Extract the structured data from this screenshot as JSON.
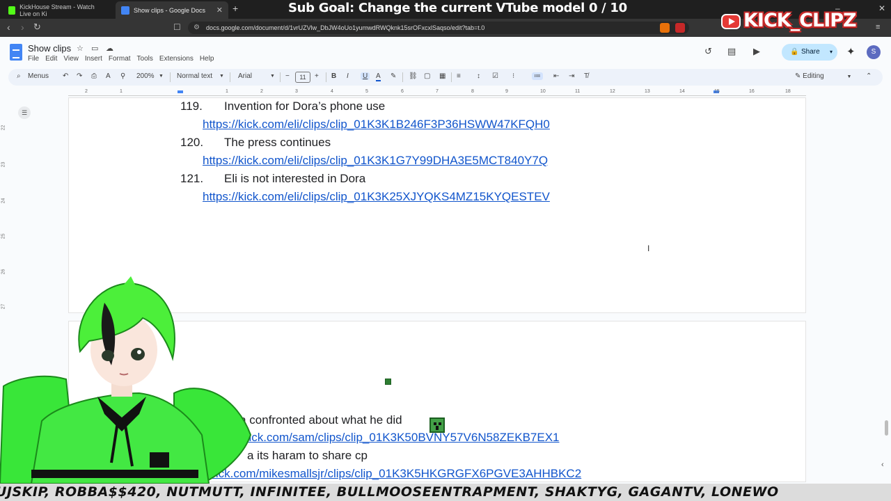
{
  "browser": {
    "tabs": [
      {
        "title": "KickHouse Stream - Watch Live on Ki",
        "icon": "kick-favicon"
      },
      {
        "title": "Show clips - Google Docs",
        "icon": "docs-favicon"
      }
    ],
    "url": "docs.google.com/document/d/1vrUZVlw_DbJW4oUo1yumwdRWQknk15srOFxcxlSaqso/edit?tab=t.0"
  },
  "overlay": {
    "subgoal": "Sub Goal: Change the current VTube model  0 / 10",
    "brand": "KICK_CLIPZ",
    "ticker": "UJSKIP, ROBBA$$420, NUTMUTT, INFINITEE, BULLMOOSEENTRAPMENT, SHAKTYG, GAGANTV, LONEWO"
  },
  "docs": {
    "title": "Show clips",
    "menu": [
      "File",
      "Edit",
      "View",
      "Insert",
      "Format",
      "Tools",
      "Extensions",
      "Help"
    ],
    "share_label": "Share",
    "avatar_letter": "S",
    "toolbar": {
      "menus": "Menus",
      "zoom": "200%",
      "style": "Normal text",
      "font": "Arial",
      "size": "11",
      "mode": "Editing"
    },
    "ruler_ticks": [
      "2",
      "1",
      "1",
      "2",
      "3",
      "4",
      "5",
      "6",
      "7",
      "8",
      "9",
      "10",
      "11",
      "12",
      "13",
      "14",
      "15",
      "16",
      "17",
      "18"
    ],
    "left_ruler": [
      "22",
      "23",
      "24",
      "25",
      "26",
      "27"
    ]
  },
  "items": [
    {
      "num": "119.",
      "title": "Invention for Dora’s phone use",
      "url": "https://kick.com/eli/clips/clip_01K3K1B246F3P36HSWW47KFQH0"
    },
    {
      "num": "120.",
      "title": "The press continues",
      "url": "https://kick.com/eli/clips/clip_01K3K1G7Y99DHA3E5MCT840Y7Q"
    },
    {
      "num": "121.",
      "title": "Eli is not interested in Dora",
      "url": "https://kick.com/eli/clips/clip_01K3K25XJYQKS4MZ15KYQESTEV"
    },
    {
      "num": "",
      "title": "ora confronted about what he did",
      "url": "kick.com/sam/clips/clip_01K3K50BVNY57V6N58ZEKB7EX1"
    },
    {
      "num": "3.",
      "title": "a its haram to share cp",
      "url": "ht    ick.com/mikesmallsjr/clips/clip_01K3K5HKGRGFX6PGVE3AHHBKC2"
    }
  ],
  "colors": {
    "link": "#1155cc",
    "share": "#c2e7ff",
    "avatar_green": "#39e639"
  }
}
